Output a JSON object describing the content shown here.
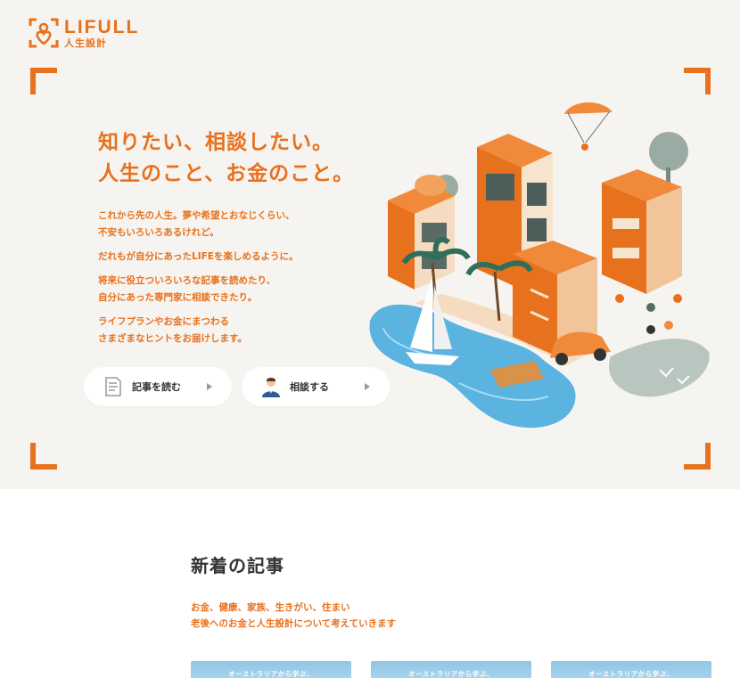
{
  "brand": {
    "name": "LIFULL",
    "sub": "人生設計",
    "color": "#e8711d"
  },
  "hero": {
    "headline_line1": "知りたい、相談したい。",
    "headline_line2": "人生のこと、お金のこと。",
    "desc": [
      [
        "これから先の人生。夢や希望とおなじくらい、",
        "不安もいろいろあるけれど。"
      ],
      [
        "だれもが自分にあったLIFEを楽しめるように。"
      ],
      [
        "将来に役立ついろいろな記事を読めたり、",
        "自分にあった専門家に相談できたり。"
      ],
      [
        "ライフプランやお金にまつわる",
        "さまざまなヒントをお届けします。"
      ]
    ],
    "buttons": {
      "read": "記事を読む",
      "consult": "相談する"
    }
  },
  "news": {
    "title": "新着の記事",
    "sub_line1": "お金、健康、家族、生きがい、住まい",
    "sub_line2": "老後へのお金と人生設計について考えていきます",
    "cards": [
      "オーストラリアから学ぶ、",
      "オーストラリアから学ぶ、",
      "オーストラリアから学ぶ、"
    ]
  },
  "icons": {
    "logo": "lifull-logo-icon",
    "read": "document-icon",
    "consult": "advisor-person-icon",
    "arrow": "play-arrow-icon"
  }
}
